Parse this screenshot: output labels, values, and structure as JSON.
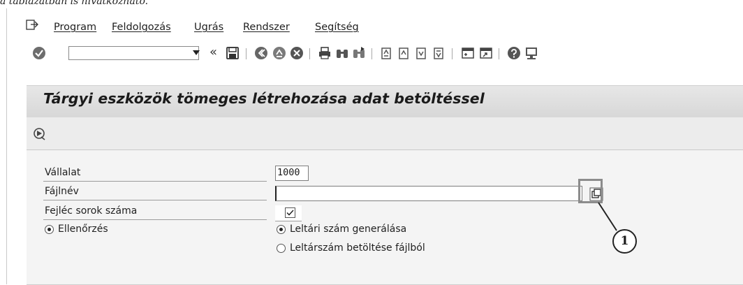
{
  "cut_caption": "a táblázatban is hivatkozható.",
  "menu": {
    "items": [
      {
        "label": "Program"
      },
      {
        "label": "Feldolgozás"
      },
      {
        "label": "Ugrás"
      },
      {
        "label": "Rendszer"
      },
      {
        "label": "Segítség"
      }
    ]
  },
  "toolbar": {
    "command_field_value": "",
    "back_symbol": "«",
    "icons": [
      "check-icon",
      "save-icon",
      "back-icon",
      "exit-icon",
      "cancel-icon",
      "print-icon",
      "find-icon",
      "find-next-icon",
      "first-page-icon",
      "previous-page-icon",
      "next-page-icon",
      "last-page-icon",
      "create-session-icon",
      "shortcut-icon",
      "help-icon",
      "customize-layout-icon"
    ]
  },
  "title": "Tárgyi eszközök tömeges létrehozása adat betöltéssel",
  "app_toolbar": {
    "execute_icon": "execute-icon"
  },
  "form": {
    "company_label": "Vállalat",
    "company_value": "1000",
    "filename_label": "Fájlnév",
    "filename_value": "",
    "header_rows_label": "Fejléc sorok száma",
    "header_rows_checked": true,
    "check_label": "Ellenőrzés",
    "check_selected": true,
    "asset_gen_label": "Leltári szám generálása",
    "asset_gen_selected": true,
    "asset_file_label": "Leltárszám betöltése fájlból",
    "asset_file_selected": false
  },
  "callout": {
    "number": "1"
  },
  "colors": {
    "title_bg": "#dcdcdc",
    "content_bg": "#f4f4f4",
    "callout_border": "#8c8c8c"
  }
}
